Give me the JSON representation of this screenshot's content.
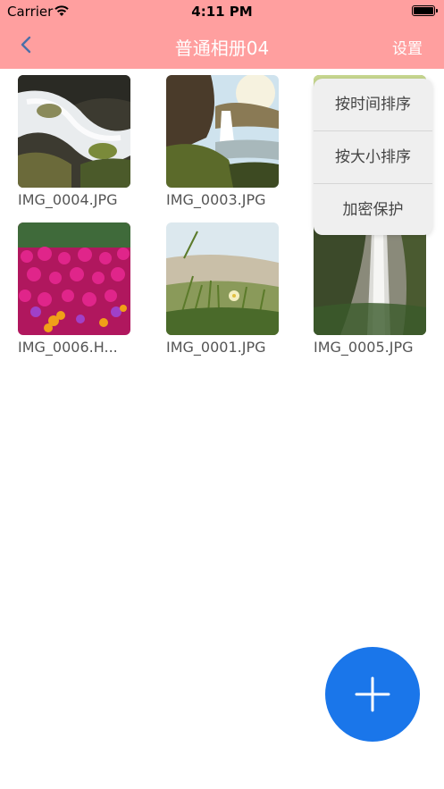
{
  "status_bar": {
    "carrier": "Carrier",
    "time": "4:11 PM"
  },
  "nav": {
    "title": "普通相册04",
    "settings_label": "设置",
    "back_icon": "chevron-left-icon"
  },
  "photos": [
    {
      "name": "IMG_0004.JPG",
      "scene": "stream-rocks"
    },
    {
      "name": "IMG_0003.JPG",
      "scene": "waterfall-cliff"
    },
    {
      "name": "",
      "scene": "green-hidden"
    },
    {
      "name": "IMG_0006.H...",
      "scene": "pink-flowers"
    },
    {
      "name": "IMG_0001.JPG",
      "scene": "grass-flower"
    },
    {
      "name": "IMG_0005.JPG",
      "scene": "tall-waterfall"
    }
  ],
  "menu": {
    "items": [
      "按时间排序",
      "按大小排序",
      "加密保护"
    ]
  },
  "fab": {
    "icon": "plus-icon"
  },
  "colors": {
    "header": "#ff9f9f",
    "fab": "#1a76ea",
    "menu_bg": "#efefef"
  }
}
